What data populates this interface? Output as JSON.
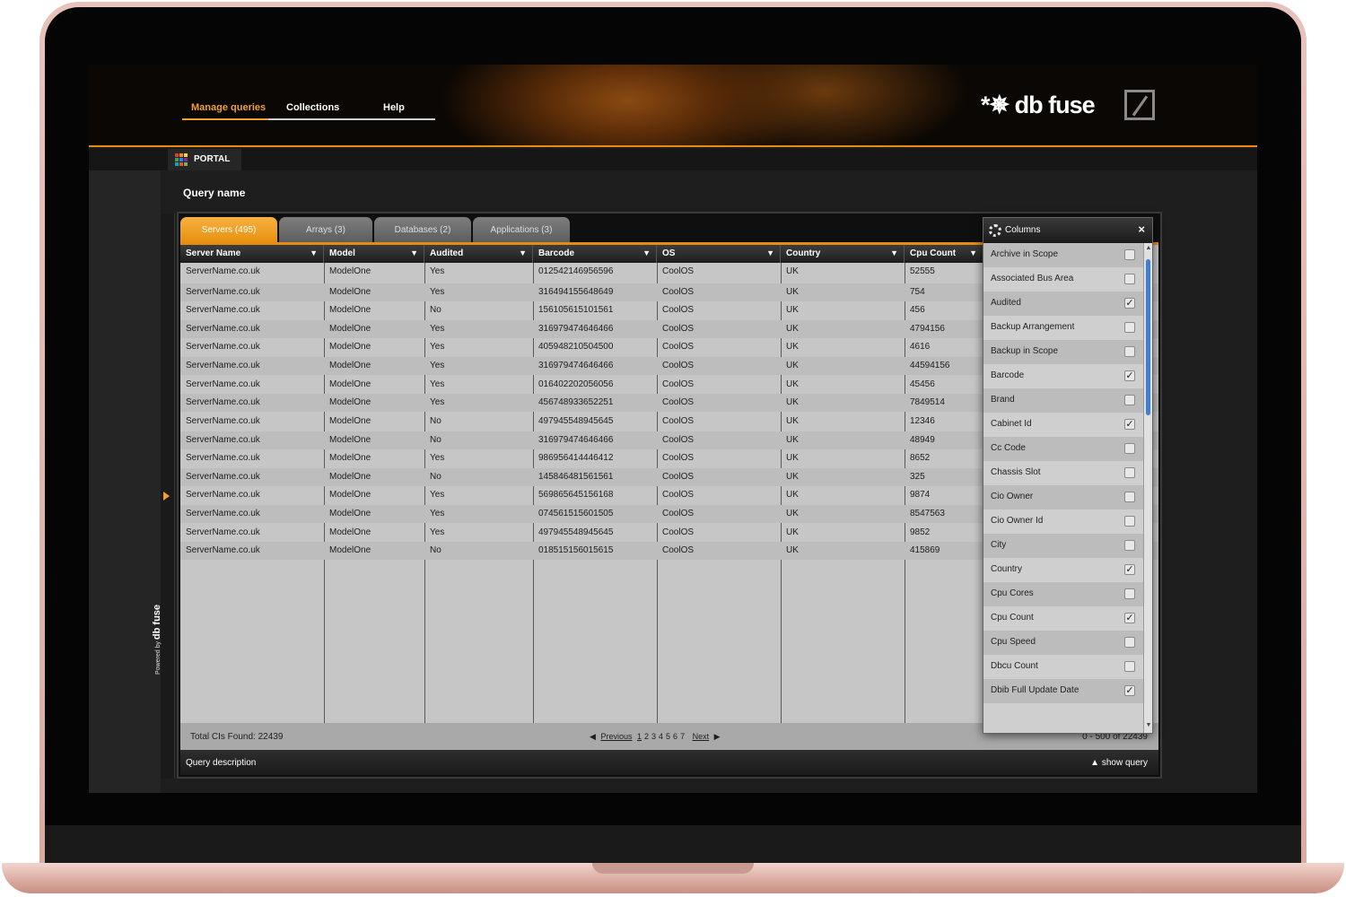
{
  "nav": {
    "items": [
      {
        "label": "Manage queries",
        "active": true
      },
      {
        "label": "Collections",
        "active": false
      },
      {
        "label": "Help",
        "active": false
      }
    ]
  },
  "brand": {
    "logo_text": "*✵ db fuse",
    "accent": "#e88a14"
  },
  "portal": {
    "label": "PORTAL",
    "grid_colors": [
      "#e53935",
      "#fb8c00",
      "#fdd835",
      "#43a047",
      "#1e88e5",
      "#8e24aa",
      "#00acc1",
      "#f4511e",
      "#7cb342"
    ]
  },
  "page": {
    "title": "Query name"
  },
  "side": {
    "powered_by": "Powered by",
    "brand": "db fuse"
  },
  "tabs": [
    {
      "label": "Servers (495)",
      "active": true
    },
    {
      "label": "Arrays (3)",
      "active": false
    },
    {
      "label": "Databases (2)",
      "active": false
    },
    {
      "label": "Applications (3)",
      "active": false
    }
  ],
  "grid": {
    "columns": [
      "Server Name",
      "Model",
      "Audited",
      "Barcode",
      "OS",
      "Country",
      "Cpu Count"
    ],
    "rows": [
      [
        "ServerName.co.uk",
        "ModelOne",
        "Yes",
        "012542146956596",
        "CoolOS",
        "UK",
        "52555"
      ],
      [
        "ServerName.co.uk",
        "ModelOne",
        "Yes",
        "316494155648649",
        "CoolOS",
        "UK",
        "754"
      ],
      [
        "ServerName.co.uk",
        "ModelOne",
        "No",
        "156105615101561",
        "CoolOS",
        "UK",
        "456"
      ],
      [
        "ServerName.co.uk",
        "ModelOne",
        "Yes",
        "316979474646466",
        "CoolOS",
        "UK",
        "4794156"
      ],
      [
        "ServerName.co.uk",
        "ModelOne",
        "Yes",
        "405948210504500",
        "CoolOS",
        "UK",
        "4616"
      ],
      [
        "ServerName.co.uk",
        "ModelOne",
        "Yes",
        "316979474646466",
        "CoolOS",
        "UK",
        "44594156"
      ],
      [
        "ServerName.co.uk",
        "ModelOne",
        "Yes",
        "016402202056056",
        "CoolOS",
        "UK",
        "45456"
      ],
      [
        "ServerName.co.uk",
        "ModelOne",
        "Yes",
        "456748933652251",
        "CoolOS",
        "UK",
        "7849514"
      ],
      [
        "ServerName.co.uk",
        "ModelOne",
        "No",
        "497945548945645",
        "CoolOS",
        "UK",
        "12346"
      ],
      [
        "ServerName.co.uk",
        "ModelOne",
        "No",
        "316979474646466",
        "CoolOS",
        "UK",
        "48949"
      ],
      [
        "ServerName.co.uk",
        "ModelOne",
        "Yes",
        "986956414446412",
        "CoolOS",
        "UK",
        "8652"
      ],
      [
        "ServerName.co.uk",
        "ModelOne",
        "No",
        "145846481561561",
        "CoolOS",
        "UK",
        "325"
      ],
      [
        "ServerName.co.uk",
        "ModelOne",
        "Yes",
        "569865645156168",
        "CoolOS",
        "UK",
        "9874"
      ],
      [
        "ServerName.co.uk",
        "ModelOne",
        "Yes",
        "074561515601505",
        "CoolOS",
        "UK",
        "8547563"
      ],
      [
        "ServerName.co.uk",
        "ModelOne",
        "Yes",
        "497945548945645",
        "CoolOS",
        "UK",
        "9852"
      ],
      [
        "ServerName.co.uk",
        "ModelOne",
        "No",
        "018515156015615",
        "CoolOS",
        "UK",
        "415869"
      ]
    ]
  },
  "footer": {
    "total": "Total CIs Found: 22439",
    "previous": "Previous",
    "pages": [
      "1",
      "2",
      "3",
      "4",
      "5",
      "6",
      "7"
    ],
    "next": "Next",
    "range": "0 - 500 of 22439"
  },
  "description_bar": {
    "label": "Query description",
    "show_query": "▲ show query"
  },
  "columns_popup": {
    "title": "Columns",
    "close": "×",
    "items": [
      {
        "label": "Archive in Scope",
        "checked": false
      },
      {
        "label": "Associated Bus Area",
        "checked": false
      },
      {
        "label": "Audited",
        "checked": true
      },
      {
        "label": "Backup Arrangement",
        "checked": false
      },
      {
        "label": "Backup in Scope",
        "checked": false
      },
      {
        "label": "Barcode",
        "checked": true
      },
      {
        "label": "Brand",
        "checked": false
      },
      {
        "label": "Cabinet Id",
        "checked": true
      },
      {
        "label": "Cc Code",
        "checked": false
      },
      {
        "label": "Chassis Slot",
        "checked": false
      },
      {
        "label": "Cio Owner",
        "checked": false
      },
      {
        "label": "Cio Owner Id",
        "checked": false
      },
      {
        "label": "City",
        "checked": false
      },
      {
        "label": "Country",
        "checked": true
      },
      {
        "label": "Cpu Cores",
        "checked": false
      },
      {
        "label": "Cpu Count",
        "checked": true
      },
      {
        "label": "Cpu Speed",
        "checked": false
      },
      {
        "label": "Dbcu Count",
        "checked": false
      },
      {
        "label": "Dbib Full Update Date",
        "checked": true
      }
    ]
  }
}
